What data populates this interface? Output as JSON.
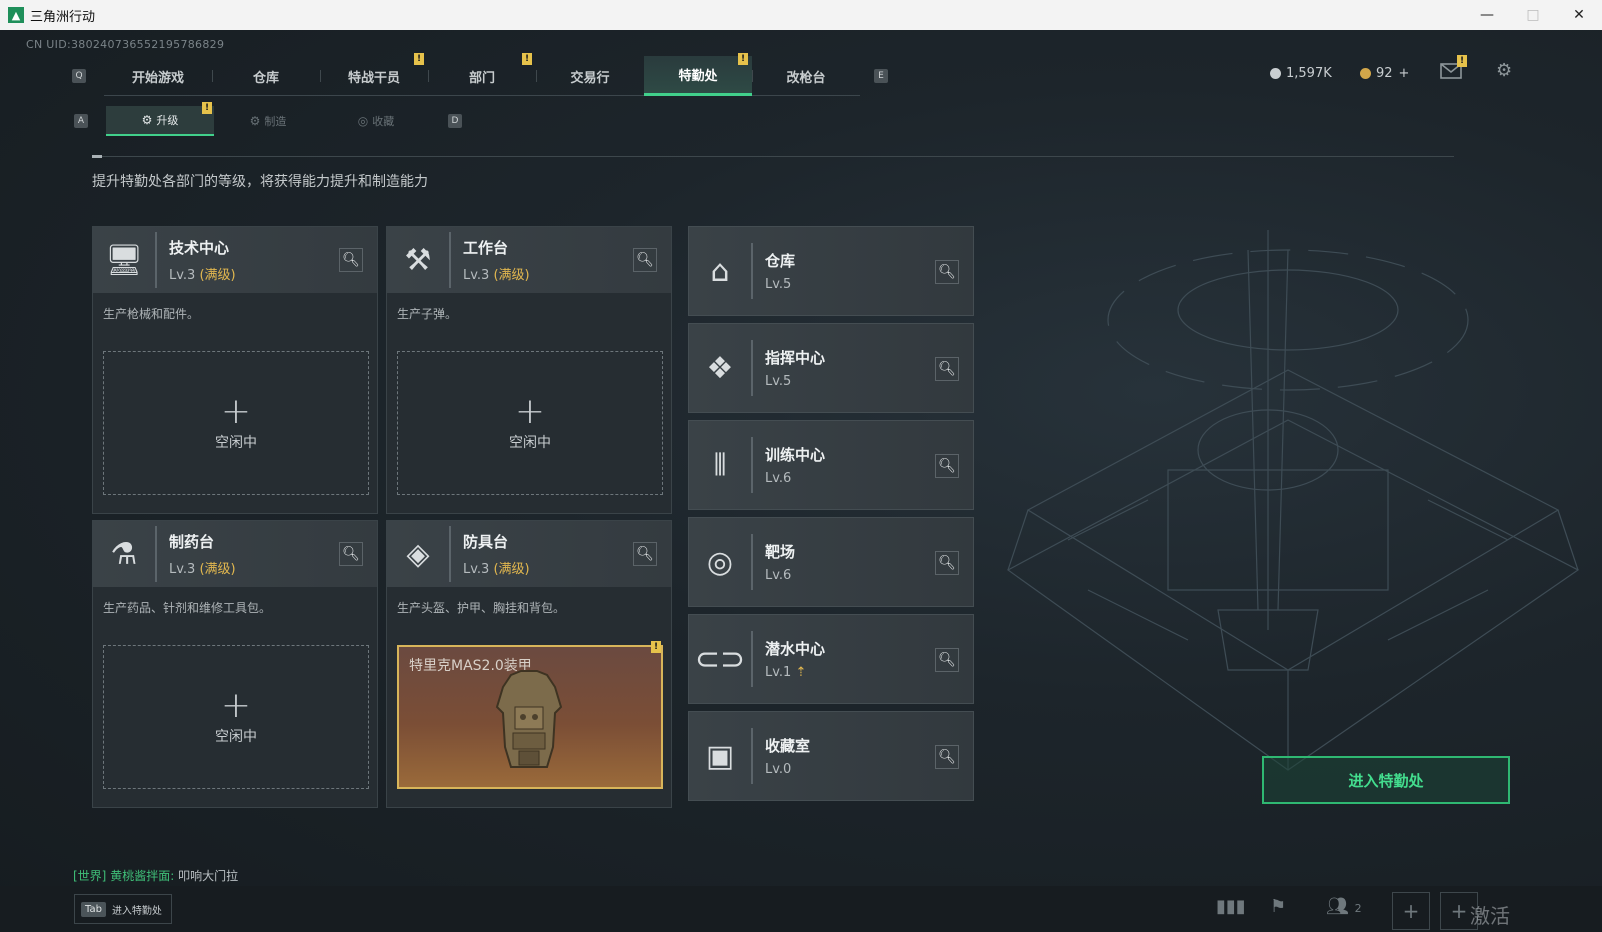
{
  "window": {
    "title": "三角洲行动",
    "minimize": "—",
    "maximize": "□",
    "close": "✕"
  },
  "uid": "CN UID:380240736552195786829",
  "nav": {
    "left_key": "Q",
    "right_key": "E",
    "tabs": [
      {
        "label": "开始游戏",
        "warn": false
      },
      {
        "label": "仓库",
        "warn": false
      },
      {
        "label": "特战干员",
        "warn": true
      },
      {
        "label": "部门",
        "warn": true
      },
      {
        "label": "交易行",
        "warn": false
      },
      {
        "label": "特勤处",
        "warn": true,
        "active": true
      },
      {
        "label": "改枪台",
        "warn": false
      }
    ]
  },
  "currency": {
    "silver": "1,597K",
    "gold": "92",
    "gold_add": "+"
  },
  "subnav": {
    "left_key": "A",
    "right_key": "D",
    "tabs": [
      {
        "label": "升级",
        "active": true,
        "warn": true
      },
      {
        "label": "制造",
        "active": false
      },
      {
        "label": "收藏",
        "active": false
      }
    ]
  },
  "warn_mark": "!",
  "description": "提升特勤处各部门的等级，将获得能力提升和制造能力",
  "workshops": [
    {
      "title": "技术中心",
      "level": "Lv.3",
      "max": "(满级)",
      "desc": "生产枪械和配件。",
      "slot": "空闲中"
    },
    {
      "title": "工作台",
      "level": "Lv.3",
      "max": "(满级)",
      "desc": "生产子弹。",
      "slot": "空闲中"
    },
    {
      "title": "制药台",
      "level": "Lv.3",
      "max": "(满级)",
      "desc": "生产药品、针剂和维修工具包。",
      "slot": "空闲中"
    },
    {
      "title": "防具台",
      "level": "Lv.3",
      "max": "(满级)",
      "desc": "生产头盔、护甲、胸挂和背包。",
      "item": "特里克MAS2.0装甲"
    }
  ],
  "plus_sign": "+",
  "facilities": [
    {
      "title": "仓库",
      "level": "Lv.5"
    },
    {
      "title": "指挥中心",
      "level": "Lv.5"
    },
    {
      "title": "训练中心",
      "level": "Lv.6"
    },
    {
      "title": "靶场",
      "level": "Lv.6"
    },
    {
      "title": "潜水中心",
      "level": "Lv.1",
      "upgrade": "⇡"
    },
    {
      "title": "收藏室",
      "level": "Lv.0"
    }
  ],
  "enter_button": "进入特勤处",
  "chat": {
    "channel": "[世界]",
    "user": "黄桃酱拌面:",
    "message": "叩响大门拉"
  },
  "tab_hint": {
    "key": "Tab",
    "label": "进入特勤处"
  },
  "bottom": {
    "friends_count": "2",
    "watermark": "激活 Windows"
  },
  "colors": {
    "accent_green": "#41d08b",
    "max_level_gold": "#e3b84f",
    "warn_yellow": "#e6c24b"
  }
}
